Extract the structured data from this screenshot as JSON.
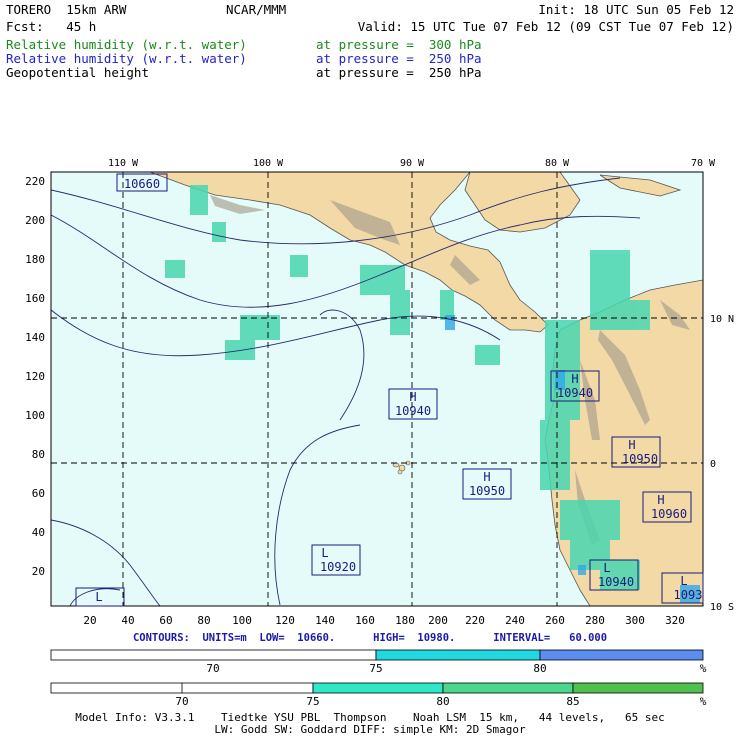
{
  "header": {
    "model": "TORERO  15km ARW",
    "org": "NCAR/MMM",
    "init": "Init: 18 UTC Sun 05 Feb 12",
    "fcst": "Fcst:   45 h",
    "valid": "Valid: 15 UTC Tue 07 Feb 12 (09 CST Tue 07 Feb 12)",
    "fields": [
      {
        "name": "Relative humidity (w.r.t. water)",
        "level": "at pressure =  300 hPa",
        "color": "#1a8a1a"
      },
      {
        "name": "Relative humidity (w.r.t. water)",
        "level": "at pressure =  250 hPa",
        "color": "#2323c8"
      },
      {
        "name": "Geopotential height",
        "level": "at pressure =  250 hPa",
        "color": "#000000"
      }
    ]
  },
  "axes": {
    "top_lon_labels": [
      "110 W",
      "100 W",
      "90 W",
      "80 W",
      "70 W"
    ],
    "right_lat_labels": [
      "10 N",
      "0",
      "10 S"
    ],
    "left_y_ticks": [
      "220",
      "200",
      "180",
      "160",
      "140",
      "120",
      "100",
      "80",
      "60",
      "40",
      "20"
    ],
    "bottom_x_ticks": [
      "20",
      "40",
      "60",
      "80",
      "100",
      "120",
      "140",
      "160",
      "180",
      "200",
      "220",
      "240",
      "260",
      "280",
      "300",
      "320"
    ]
  },
  "height_centers": [
    {
      "type": "",
      "value": "10660"
    },
    {
      "type": "H",
      "value": "10940"
    },
    {
      "type": "H",
      "value": "10940"
    },
    {
      "type": "H",
      "value": "10950"
    },
    {
      "type": "H",
      "value": "10950"
    },
    {
      "type": "H",
      "value": "10960"
    },
    {
      "type": "L",
      "value": "10920"
    },
    {
      "type": "L",
      "value": "10940"
    },
    {
      "type": "L",
      "value": "1093"
    },
    {
      "type": "L",
      "value": ""
    }
  ],
  "contours_line": "CONTOURS:  UNITS=m  LOW=  10660.      HIGH=  10980.      INTERVAL=   60.000",
  "colorbars": [
    {
      "labels": [
        "70",
        "75",
        "80",
        "%"
      ],
      "colors": [
        "#ffffff",
        "#ffffff",
        "#22d8e0",
        "#5b8ef0"
      ]
    },
    {
      "labels": [
        "70",
        "75",
        "80",
        "85",
        "%"
      ],
      "colors": [
        "#ffffff",
        "#ffffff",
        "#2ee8c8",
        "#4ad88c",
        "#50c050"
      ]
    }
  ],
  "footer": {
    "line1": "Model Info: V3.3.1    Tiedtke YSU PBL  Thompson    Noah LSM  15 km,   44 levels,   65 sec",
    "line2": "LW: Godd SW: Goddard DIFF: simple KM: 2D Smagor"
  }
}
